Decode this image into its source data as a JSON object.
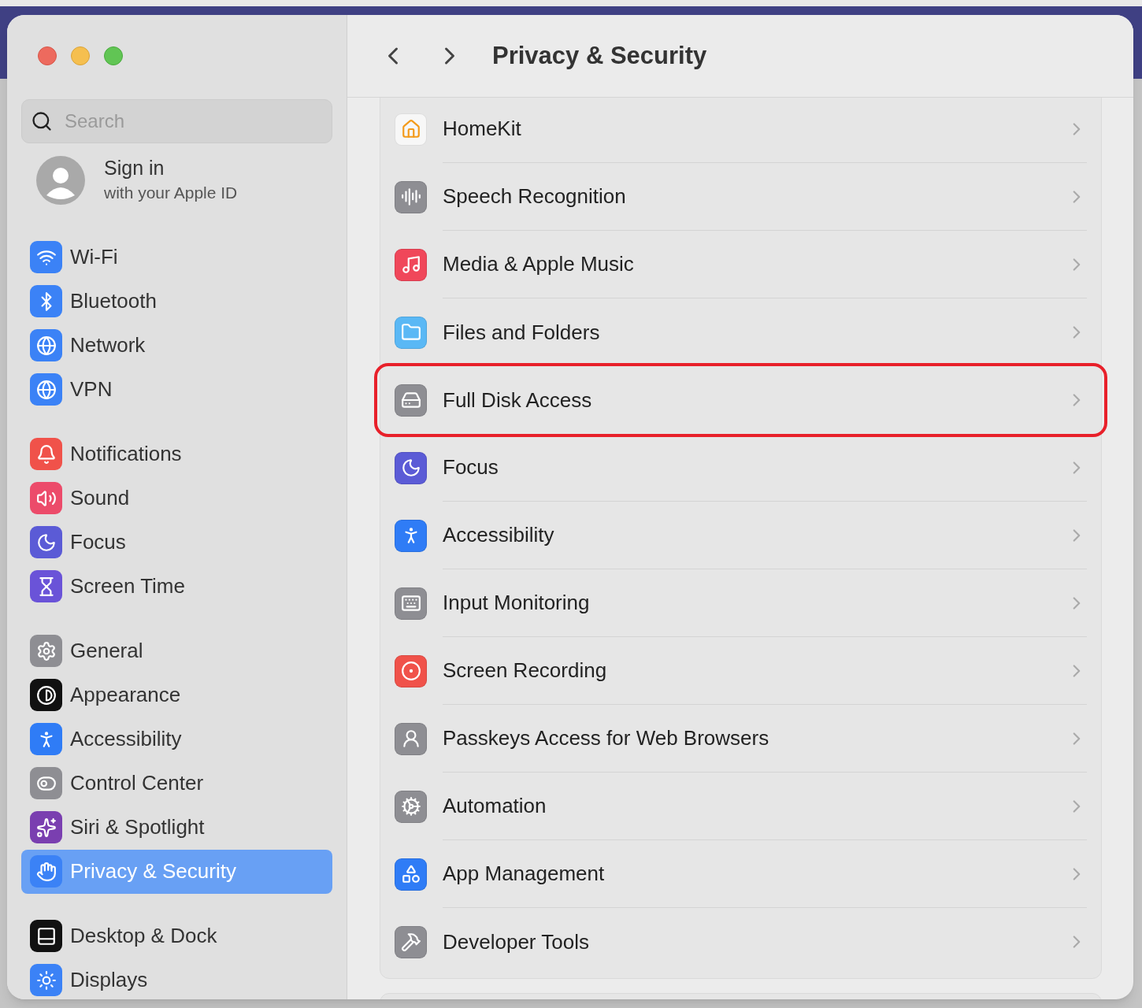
{
  "window": {
    "title": "Privacy & Security"
  },
  "search": {
    "placeholder": "Search"
  },
  "account": {
    "title": "Sign in",
    "subtitle": "with your Apple ID"
  },
  "sidebar": {
    "groups": [
      {
        "items": [
          {
            "label": "Wi-Fi",
            "color": "#3b82f6",
            "selected": false
          },
          {
            "label": "Bluetooth",
            "color": "#3b82f6",
            "selected": false
          },
          {
            "label": "Network",
            "color": "#3b82f6",
            "selected": false
          },
          {
            "label": "VPN",
            "color": "#3b82f6",
            "selected": false
          }
        ]
      },
      {
        "items": [
          {
            "label": "Notifications",
            "color": "#f0524a",
            "selected": false
          },
          {
            "label": "Sound",
            "color": "#ec4b6a",
            "selected": false
          },
          {
            "label": "Focus",
            "color": "#5b5bd6",
            "selected": false
          },
          {
            "label": "Screen Time",
            "color": "#6a53d8",
            "selected": false
          }
        ]
      },
      {
        "items": [
          {
            "label": "General",
            "color": "#8e8e93",
            "selected": false
          },
          {
            "label": "Appearance",
            "color": "#111111",
            "selected": false
          },
          {
            "label": "Accessibility",
            "color": "#2f7cf6",
            "selected": false
          },
          {
            "label": "Control Center",
            "color": "#8e8e93",
            "selected": false
          },
          {
            "label": "Siri & Spotlight",
            "color": "#7a3fb0",
            "selected": false
          },
          {
            "label": "Privacy & Security",
            "color": "#3b82f6",
            "selected": true
          }
        ]
      },
      {
        "items": [
          {
            "label": "Desktop & Dock",
            "color": "#111111",
            "selected": false
          },
          {
            "label": "Displays",
            "color": "#3b82f6",
            "selected": false
          }
        ]
      }
    ]
  },
  "rows": [
    {
      "label": "HomeKit",
      "color": "#f7f7f7",
      "highlighted": false
    },
    {
      "label": "Speech Recognition",
      "color": "#8e8e93",
      "highlighted": false
    },
    {
      "label": "Media & Apple Music",
      "color": "#f0475a",
      "highlighted": false
    },
    {
      "label": "Files and Folders",
      "color": "#5ab8f5",
      "highlighted": false
    },
    {
      "label": "Full Disk Access",
      "color": "#8e8e93",
      "highlighted": true
    },
    {
      "label": "Focus",
      "color": "#5b5bd6",
      "highlighted": false
    },
    {
      "label": "Accessibility",
      "color": "#2f7cf6",
      "highlighted": false
    },
    {
      "label": "Input Monitoring",
      "color": "#8e8e93",
      "highlighted": false
    },
    {
      "label": "Screen Recording",
      "color": "#f0524a",
      "highlighted": false
    },
    {
      "label": "Passkeys Access for Web Browsers",
      "color": "#8e8e93",
      "highlighted": false
    },
    {
      "label": "Automation",
      "color": "#8e8e93",
      "highlighted": false
    },
    {
      "label": "App Management",
      "color": "#2f7cf6",
      "highlighted": false
    },
    {
      "label": "Developer Tools",
      "color": "#8e8e93",
      "highlighted": false
    }
  ]
}
